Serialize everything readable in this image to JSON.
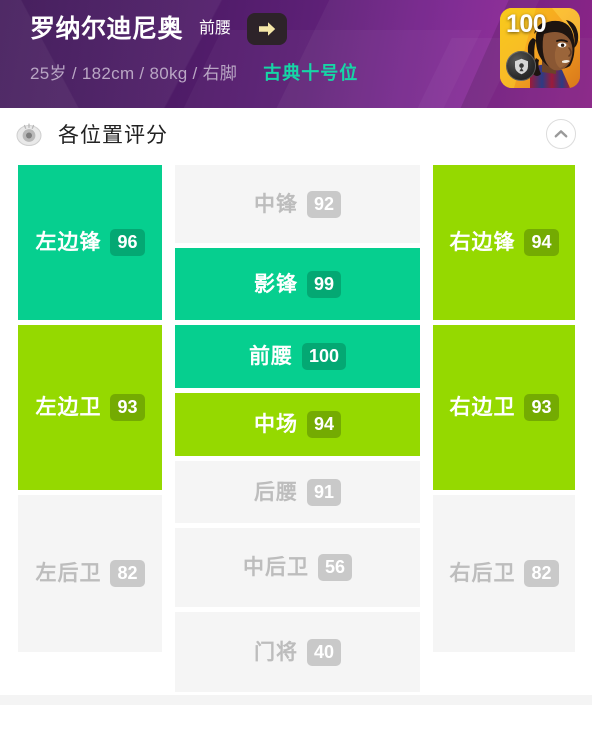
{
  "header": {
    "player_name": "罗纳尔迪尼奥",
    "current_position": "前腰",
    "arrow_icon": "arrow-right-icon",
    "meta": "25岁 / 182cm / 80kg / 右脚",
    "play_style": "古典十号位",
    "card": {
      "rating": "100",
      "badge_icon": "shield-icon"
    },
    "colors": {
      "gradient_start": "#3b1254",
      "gradient_end": "#9e2a9b",
      "style_text": "#16d6a6",
      "meta_text": "#b9a6c4",
      "arrow_button_bg": "#2d2329",
      "arrow_glyph": "#f5e6a8"
    }
  },
  "section": {
    "title": "各位置评分",
    "icon": "whistle-icon",
    "collapse_icon": "chevron-up-icon"
  },
  "chart_data": {
    "type": "table",
    "title": "各位置评分",
    "xlabel": "",
    "ylabel": "",
    "categories": [
      "左边锋",
      "中锋",
      "右边锋",
      "影锋",
      "左边卫",
      "前腰",
      "右边卫",
      "中场",
      "后腰",
      "左后卫",
      "中后卫",
      "右后卫",
      "门将"
    ],
    "values": [
      96,
      92,
      94,
      99,
      93,
      100,
      93,
      94,
      91,
      82,
      56,
      82,
      40
    ],
    "tiers": [
      "teal",
      "gray",
      "green",
      "teal",
      "green",
      "teal",
      "green",
      "green",
      "gray",
      "gray",
      "gray",
      "gray",
      "gray"
    ],
    "tier_colors": {
      "teal": "#06cf8f",
      "green": "#95d900",
      "gray": "#f5f5f5"
    }
  },
  "positions": {
    "lw": {
      "label": "左边锋",
      "score": "96"
    },
    "st": {
      "label": "中锋",
      "score": "92"
    },
    "rw": {
      "label": "右边锋",
      "score": "94"
    },
    "cf": {
      "label": "影锋",
      "score": "99"
    },
    "lm": {
      "label": "左边卫",
      "score": "93"
    },
    "cam": {
      "label": "前腰",
      "score": "100"
    },
    "rm": {
      "label": "右边卫",
      "score": "93"
    },
    "cm": {
      "label": "中场",
      "score": "94"
    },
    "cdm": {
      "label": "后腰",
      "score": "91"
    },
    "lb": {
      "label": "左后卫",
      "score": "82"
    },
    "cb": {
      "label": "中后卫",
      "score": "56"
    },
    "rb": {
      "label": "右后卫",
      "score": "82"
    },
    "gk": {
      "label": "门将",
      "score": "40"
    }
  }
}
